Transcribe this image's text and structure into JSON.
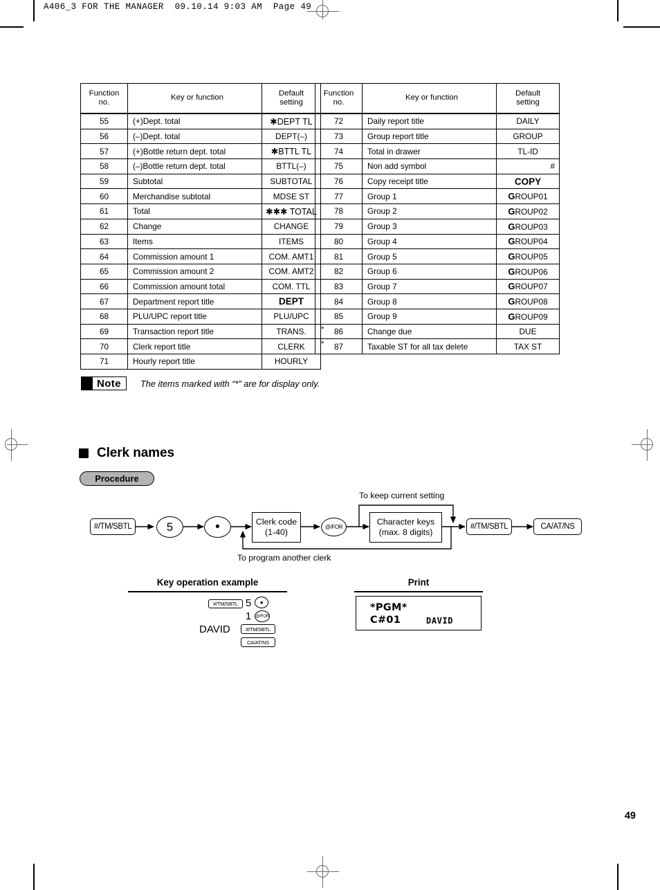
{
  "header": {
    "text": "A406_3 FOR THE MANAGER  09.10.14 9:03 AM  Page 49"
  },
  "page_number": "49",
  "tables": {
    "columns": [
      "Function\nno.",
      "Key or function",
      "Default\nsetting"
    ],
    "col_no_line1": "Function",
    "col_no_line2": "no.",
    "col_key": "Key or function",
    "col_def_line1": "Default",
    "col_def_line2": "setting",
    "left_rows": [
      {
        "no": "55",
        "key": "(+)Dept. total",
        "def": "✱DEPT TL",
        "style": "normal"
      },
      {
        "no": "56",
        "key": "(–)Dept. total",
        "def": "DEPT(–)",
        "style": "normal"
      },
      {
        "no": "57",
        "key": "(+)Bottle return dept. total",
        "def": "✱BTTL TL",
        "style": "normal"
      },
      {
        "no": "58",
        "key": "(–)Bottle return dept. total",
        "def": "BTTL(–)",
        "style": "normal"
      },
      {
        "no": "59",
        "key": "Subtotal",
        "def": "SUBTOTAL",
        "style": "normal"
      },
      {
        "no": "60",
        "key": "Merchandise subtotal",
        "def": "MDSE ST",
        "style": "normal"
      },
      {
        "no": "61",
        "key": "Total",
        "def": "✱✱✱ TOTAL",
        "style": "normal"
      },
      {
        "no": "62",
        "key": "Change",
        "def": "CHANGE",
        "style": "normal"
      },
      {
        "no": "63",
        "key": "Items",
        "def": "ITEMS",
        "style": "normal"
      },
      {
        "no": "64",
        "key": "Commission amount 1",
        "def": "COM. AMT1",
        "style": "normal"
      },
      {
        "no": "65",
        "key": "Commission amount 2",
        "def": "COM. AMT2",
        "style": "normal"
      },
      {
        "no": "66",
        "key": "Commission amount total",
        "def": "COM. TTL",
        "style": "normal"
      },
      {
        "no": "67",
        "key": "Department report title",
        "def": "DEPT",
        "style": "bold"
      },
      {
        "no": "68",
        "key": "PLU/UPC report title",
        "def": "PLU/UPC",
        "style": "normal"
      },
      {
        "no": "69",
        "key": "Transaction report title",
        "def": "TRANS.",
        "style": "normal"
      },
      {
        "no": "70",
        "key": "Clerk report title",
        "def": "CLERK",
        "style": "normal"
      },
      {
        "no": "71",
        "key": "Hourly report title",
        "def": "HOURLY",
        "style": "normal"
      }
    ],
    "right_rows": [
      {
        "no": "72",
        "key": "Daily report title",
        "def": "DAILY",
        "style": "normal",
        "star": false
      },
      {
        "no": "73",
        "key": "Group report title",
        "def": "GROUP",
        "style": "normal",
        "star": false
      },
      {
        "no": "74",
        "key": "Total in drawer",
        "def": "TL-ID",
        "style": "normal",
        "star": false
      },
      {
        "no": "75",
        "key": "Non add symbol",
        "def": "#",
        "style": "right",
        "star": false
      },
      {
        "no": "76",
        "key": "Copy receipt title",
        "def": "COPY",
        "style": "bold",
        "star": false
      },
      {
        "no": "77",
        "key": "Group 1",
        "def": "GROUP01",
        "style": "group",
        "star": false
      },
      {
        "no": "78",
        "key": "Group 2",
        "def": "GROUP02",
        "style": "group",
        "star": false
      },
      {
        "no": "79",
        "key": "Group 3",
        "def": "GROUP03",
        "style": "group",
        "star": false
      },
      {
        "no": "80",
        "key": "Group 4",
        "def": "GROUP04",
        "style": "group",
        "star": false
      },
      {
        "no": "81",
        "key": "Group 5",
        "def": "GROUP05",
        "style": "group",
        "star": false
      },
      {
        "no": "82",
        "key": "Group 6",
        "def": "GROUP06",
        "style": "group",
        "star": false
      },
      {
        "no": "83",
        "key": "Group 7",
        "def": "GROUP07",
        "style": "group",
        "star": false
      },
      {
        "no": "84",
        "key": "Group 8",
        "def": "GROUP08",
        "style": "group",
        "star": false
      },
      {
        "no": "85",
        "key": "Group 9",
        "def": "GROUP09",
        "style": "group",
        "star": false
      },
      {
        "no": "86",
        "key": "Change due",
        "def": "DUE",
        "style": "normal",
        "star": true
      },
      {
        "no": "87",
        "key": "Taxable ST for all tax delete",
        "def": "TAX ST",
        "style": "normal",
        "star": true
      }
    ]
  },
  "note": {
    "label": "Note",
    "text": "The items marked with “*” are for display only."
  },
  "section": {
    "heading": "Clerk names",
    "procedure_pill": "Procedure"
  },
  "flow": {
    "label_keep": "To keep current setting",
    "label_another": "To program another clerk",
    "node_sbtl_1": "#/TM/SBTL",
    "node_five": "5",
    "node_dot": "•",
    "node_clerk_code_line1": "Clerk code",
    "node_clerk_code_line2": "(1-40)",
    "node_atfor": "@/FOR",
    "node_charkeys_line1": "Character keys",
    "node_charkeys_line2": "(max. 8 digits)",
    "node_sbtl_2": "#/TM/SBTL",
    "node_caatns": "CA/AT/NS"
  },
  "example": {
    "title": "Key operation example",
    "keys": {
      "sbtl_a": "#/TM/SBTL",
      "five": "5",
      "dot": "•",
      "one": "1",
      "atfor": "@/FOR",
      "david": "DAVID",
      "sbtl_b": "#/TM/SBTL",
      "caatns": "CA/AT/NS"
    }
  },
  "print": {
    "title": "Print",
    "receipt_line1": "*PGM*",
    "receipt_line2_left": "C#01",
    "receipt_line2_right": "DAVID"
  }
}
